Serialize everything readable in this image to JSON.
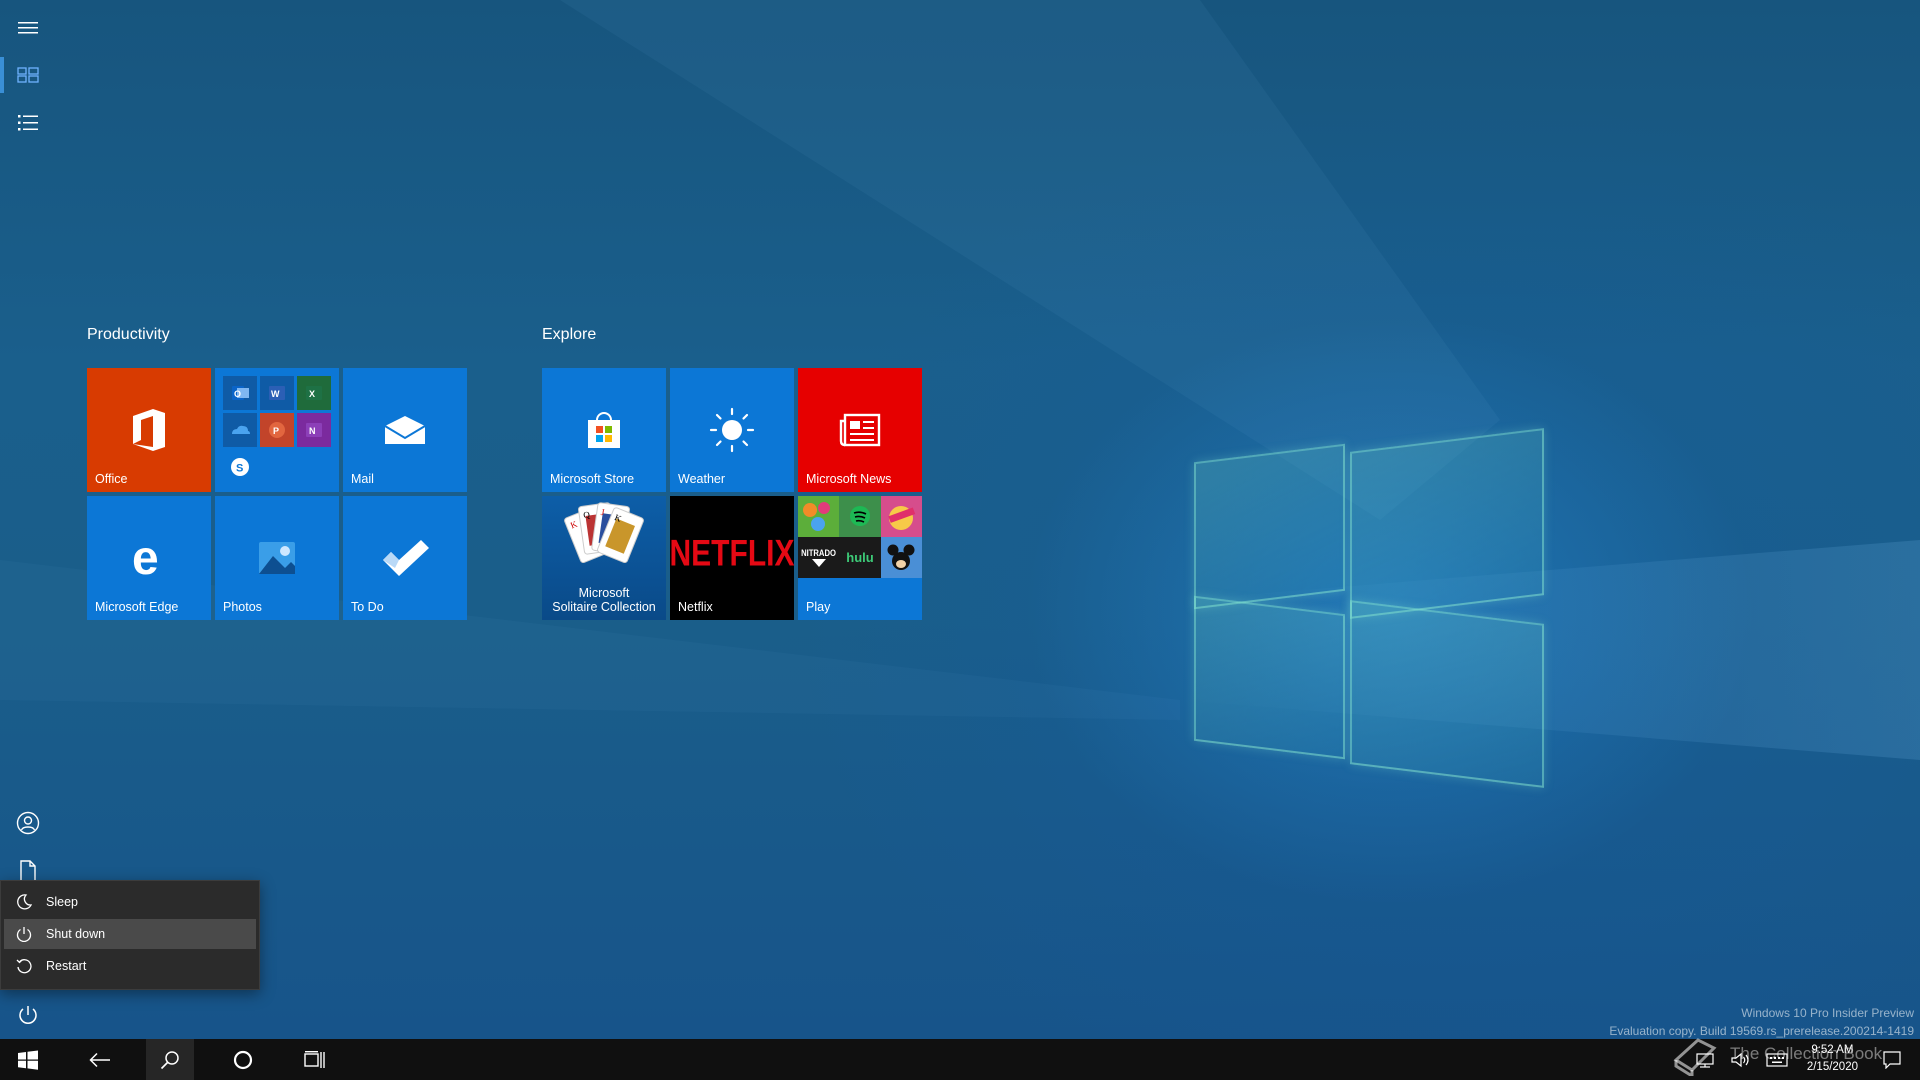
{
  "start_menu": {
    "rail": {
      "expand_tooltip": "",
      "items": [
        "menu",
        "tiles",
        "all-apps",
        "account",
        "documents",
        "power"
      ]
    },
    "groups": [
      {
        "title": "Productivity",
        "tiles": [
          {
            "label": "Office",
            "color": "#d83b01"
          },
          {
            "label": "",
            "color": "#0c77d6"
          },
          {
            "label": "Mail",
            "color": "#0c77d6"
          },
          {
            "label": "Microsoft Edge",
            "color": "#0c77d6"
          },
          {
            "label": "Photos",
            "color": "#0c77d6"
          },
          {
            "label": "To Do",
            "color": "#0c77d6"
          }
        ]
      },
      {
        "title": "Explore",
        "tiles": [
          {
            "label": "Microsoft Store",
            "color": "#0c77d6"
          },
          {
            "label": "Weather",
            "color": "#0c77d6"
          },
          {
            "label": "Microsoft News",
            "color": "#e60000"
          },
          {
            "label": "Microsoft Solitaire Collection",
            "color": "#0c4f8f"
          },
          {
            "label": "Netflix",
            "color": "#000000"
          },
          {
            "label": "Play",
            "color": "#0c77d6"
          }
        ]
      }
    ],
    "solitaire_label_line1": "Microsoft",
    "solitaire_label_line2": "Solitaire Collection",
    "netflix_logo": "NETFLIX",
    "play_labels": {
      "nitrado": "NITRADO",
      "hulu": "hulu"
    },
    "power_menu": {
      "items": [
        {
          "label": "Sleep",
          "icon": "moon-icon"
        },
        {
          "label": "Shut down",
          "icon": "power-icon",
          "highlighted": true
        },
        {
          "label": "Restart",
          "icon": "restart-icon"
        }
      ]
    }
  },
  "watermark": {
    "line1": "Windows 10 Pro Insider Preview",
    "line2": "Evaluation copy. Build 19569.rs_prerelease.200214-1419",
    "overlay": "The Collection Book"
  },
  "taskbar": {
    "clock_time": "9:52 AM",
    "clock_date": "2/15/2020"
  },
  "colors": {
    "accent": "#0c77d6",
    "office": "#d83b01",
    "news": "#e60000",
    "netflix_red": "#e50914",
    "taskbar": "#101010"
  }
}
